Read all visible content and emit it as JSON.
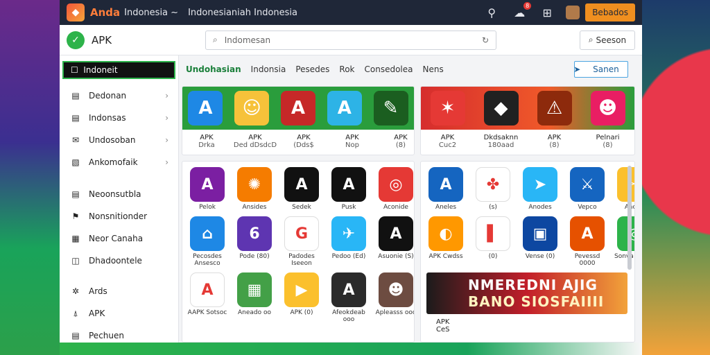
{
  "topbar": {
    "brand": "Anda",
    "title1": "Indonesia ~",
    "title2": "Indonesianiah Indonesia",
    "notif_count": "8",
    "action_label": "Bebados"
  },
  "header": {
    "app_title": "APK",
    "search_placeholder": "Indomesan",
    "search_button": "Seeson"
  },
  "sidebar": {
    "active": "Indoneit",
    "items": [
      {
        "label": "Dedonan",
        "icon": "document-icon"
      },
      {
        "label": "Indonsas",
        "icon": "document-icon"
      },
      {
        "label": "Undosoban",
        "icon": "mail-icon"
      },
      {
        "label": "Ankomofaik",
        "icon": "image-icon"
      },
      {
        "label": "Neoonsutbla",
        "icon": "document-icon"
      },
      {
        "label": "Nonsnitionder",
        "icon": "flag-icon"
      },
      {
        "label": "Neor Canaha",
        "icon": "grid-icon"
      },
      {
        "label": "Dhadoontele",
        "icon": "camera-icon"
      },
      {
        "label": "Ards",
        "icon": "star-icon"
      },
      {
        "label": "APK",
        "icon": "apk-icon"
      },
      {
        "label": "Pechuen",
        "icon": "document-icon"
      }
    ]
  },
  "tabs": [
    "Undohasian",
    "Indonsia",
    "Pesedes",
    "Rok",
    "Consedolea",
    "Nens"
  ],
  "tab_button": "Sanen",
  "featured_left": [
    {
      "title": "APK",
      "sub": "Drka",
      "color": "#1e88e5",
      "glyph": "A"
    },
    {
      "title": "APK",
      "sub": "Ded dDsdcD",
      "color": "#f6c23a",
      "glyph": "☺"
    },
    {
      "title": "APK",
      "sub": "(Dds$",
      "color": "#c62828",
      "glyph": "A"
    },
    {
      "title": "APK",
      "sub": "Nop",
      "color": "#2db3e6",
      "glyph": "A"
    },
    {
      "title": "APK",
      "sub": "(8)",
      "color": "#1b5e20",
      "glyph": "✎"
    }
  ],
  "featured_right": [
    {
      "title": "APK",
      "sub": "Cuc2",
      "color": "#e53935",
      "glyph": "✶"
    },
    {
      "title": "Dkdsaknn",
      "sub": "180aad",
      "color": "#212121",
      "glyph": "◆"
    },
    {
      "title": "APK",
      "sub": "(8)",
      "color": "#8d2a0c",
      "glyph": "⚠"
    },
    {
      "title": "Pelnari",
      "sub": "(8)",
      "color": "#e91e63",
      "glyph": "☻"
    }
  ],
  "grid_left": [
    {
      "label": "Pelok",
      "color": "#7b1fa2",
      "glyph": "A"
    },
    {
      "label": "Ansides",
      "color": "#f57c00",
      "glyph": "✺"
    },
    {
      "label": "Sedek",
      "color": "#111111",
      "glyph": "A"
    },
    {
      "label": "Pusk",
      "color": "#111111",
      "glyph": "A"
    },
    {
      "label": "Aconide",
      "color": "#e53935",
      "glyph": "◎"
    },
    {
      "label": "Pecosdes Ansesco",
      "color": "#1e88e5",
      "glyph": "⌂"
    },
    {
      "label": "Pode (80)",
      "color": "#5e35b1",
      "glyph": "6"
    },
    {
      "label": "Padodes Iseeon",
      "color": "#ffffff",
      "glyph": "G"
    },
    {
      "label": "Pedoo (Ed)",
      "color": "#29b6f6",
      "glyph": "✈"
    },
    {
      "label": "Asuonie (S)",
      "color": "#111111",
      "glyph": "A"
    },
    {
      "label": "AAPK Sotsoc",
      "color": "#ffffff",
      "glyph": "A"
    },
    {
      "label": "Aneado oo",
      "color": "#43a047",
      "glyph": "▦"
    },
    {
      "label": "APK (0)",
      "color": "#fbc02d",
      "glyph": "▶"
    },
    {
      "label": "Afeokdeab ooo",
      "color": "#2b2b2b",
      "glyph": "A"
    },
    {
      "label": "Apleasss ooo",
      "color": "#6d4c41",
      "glyph": "☻"
    }
  ],
  "grid_right": [
    {
      "label": "Aneles",
      "color": "#1565c0",
      "glyph": "A"
    },
    {
      "label": "(s)",
      "color": "#ffffff",
      "glyph": "✤"
    },
    {
      "label": "Anodes",
      "color": "#29b6f6",
      "glyph": "➤"
    },
    {
      "label": "Vepco",
      "color": "#1565c0",
      "glyph": "⚔"
    },
    {
      "label": "Aacier",
      "color": "#fbc02d",
      "glyph": "✂"
    },
    {
      "label": "APK Cwdss",
      "color": "#ff9800",
      "glyph": "◐"
    },
    {
      "label": "(0)",
      "color": "#ffffff",
      "glyph": "▌"
    },
    {
      "label": "Vense (0)",
      "color": "#0d47a1",
      "glyph": "▣"
    },
    {
      "label": "Pevessd 0000",
      "color": "#e65100",
      "glyph": "A"
    },
    {
      "label": "Sonva (Vess)",
      "color": "#2db34a",
      "glyph": "◎"
    }
  ],
  "banner": {
    "line1": "NMEREDNI AJIG",
    "line2": "BANO SIOSFAIIII",
    "caption": "APK",
    "sub": "CeS"
  }
}
